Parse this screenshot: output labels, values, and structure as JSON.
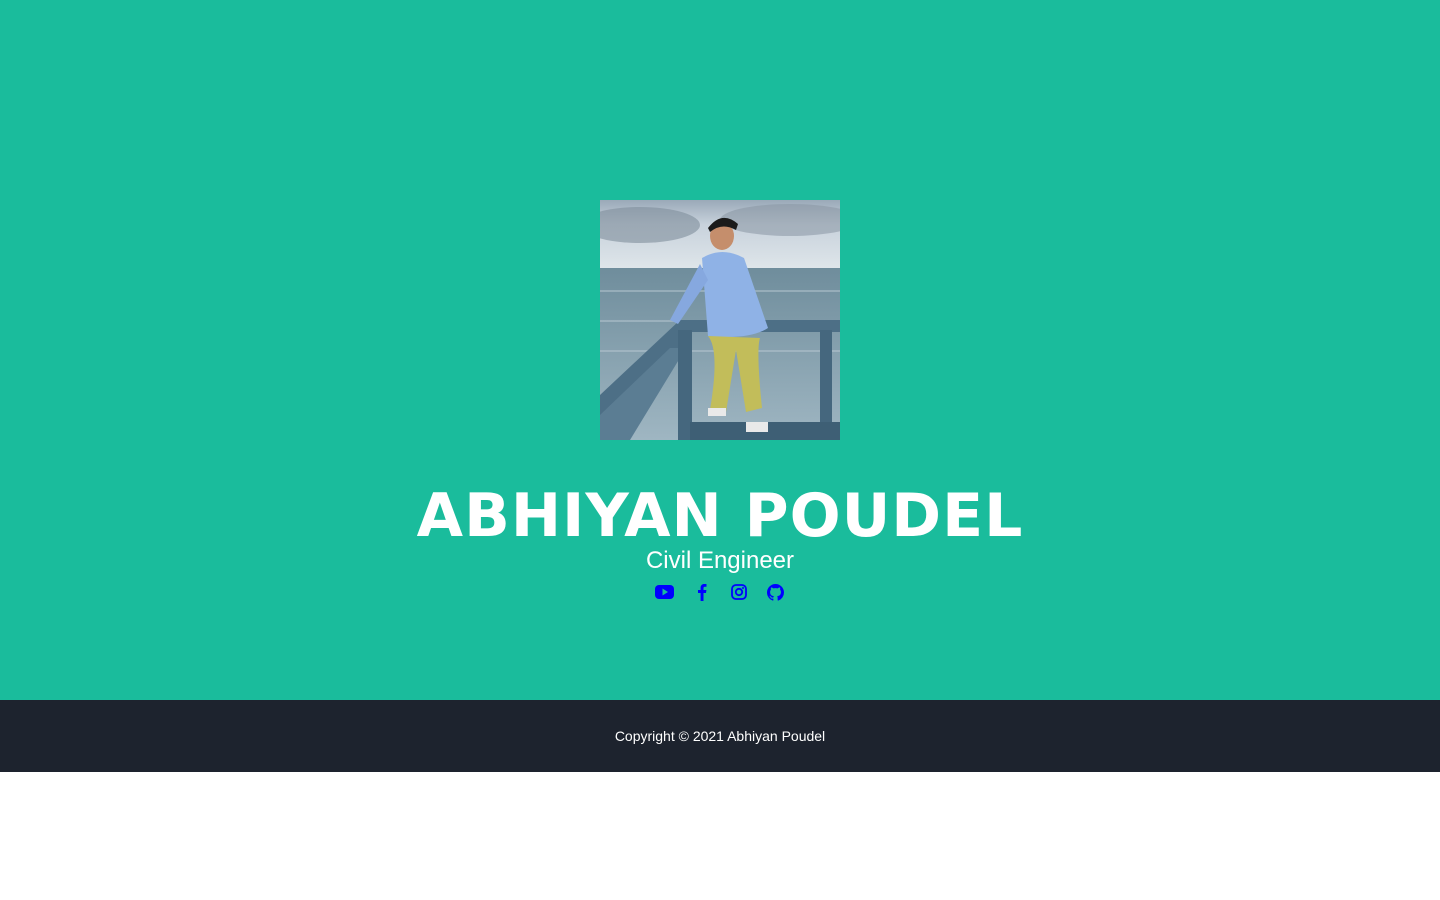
{
  "profile": {
    "photo_alt": "profile-photo",
    "name": "ABHIYAN POUDEL",
    "title": "Civil Engineer"
  },
  "social_links": [
    {
      "icon": "youtube-icon",
      "label": "YouTube"
    },
    {
      "icon": "facebook-icon",
      "label": "Facebook"
    },
    {
      "icon": "instagram-icon",
      "label": "Instagram"
    },
    {
      "icon": "github-icon",
      "label": "GitHub"
    }
  ],
  "footer": {
    "copyright": "Copyright © 2021 Abhiyan Poudel"
  },
  "colors": {
    "masthead_bg": "#1abc9c",
    "footer_bg": "#1d232e",
    "icon_color": "#0000ff",
    "text_color": "#ffffff"
  }
}
